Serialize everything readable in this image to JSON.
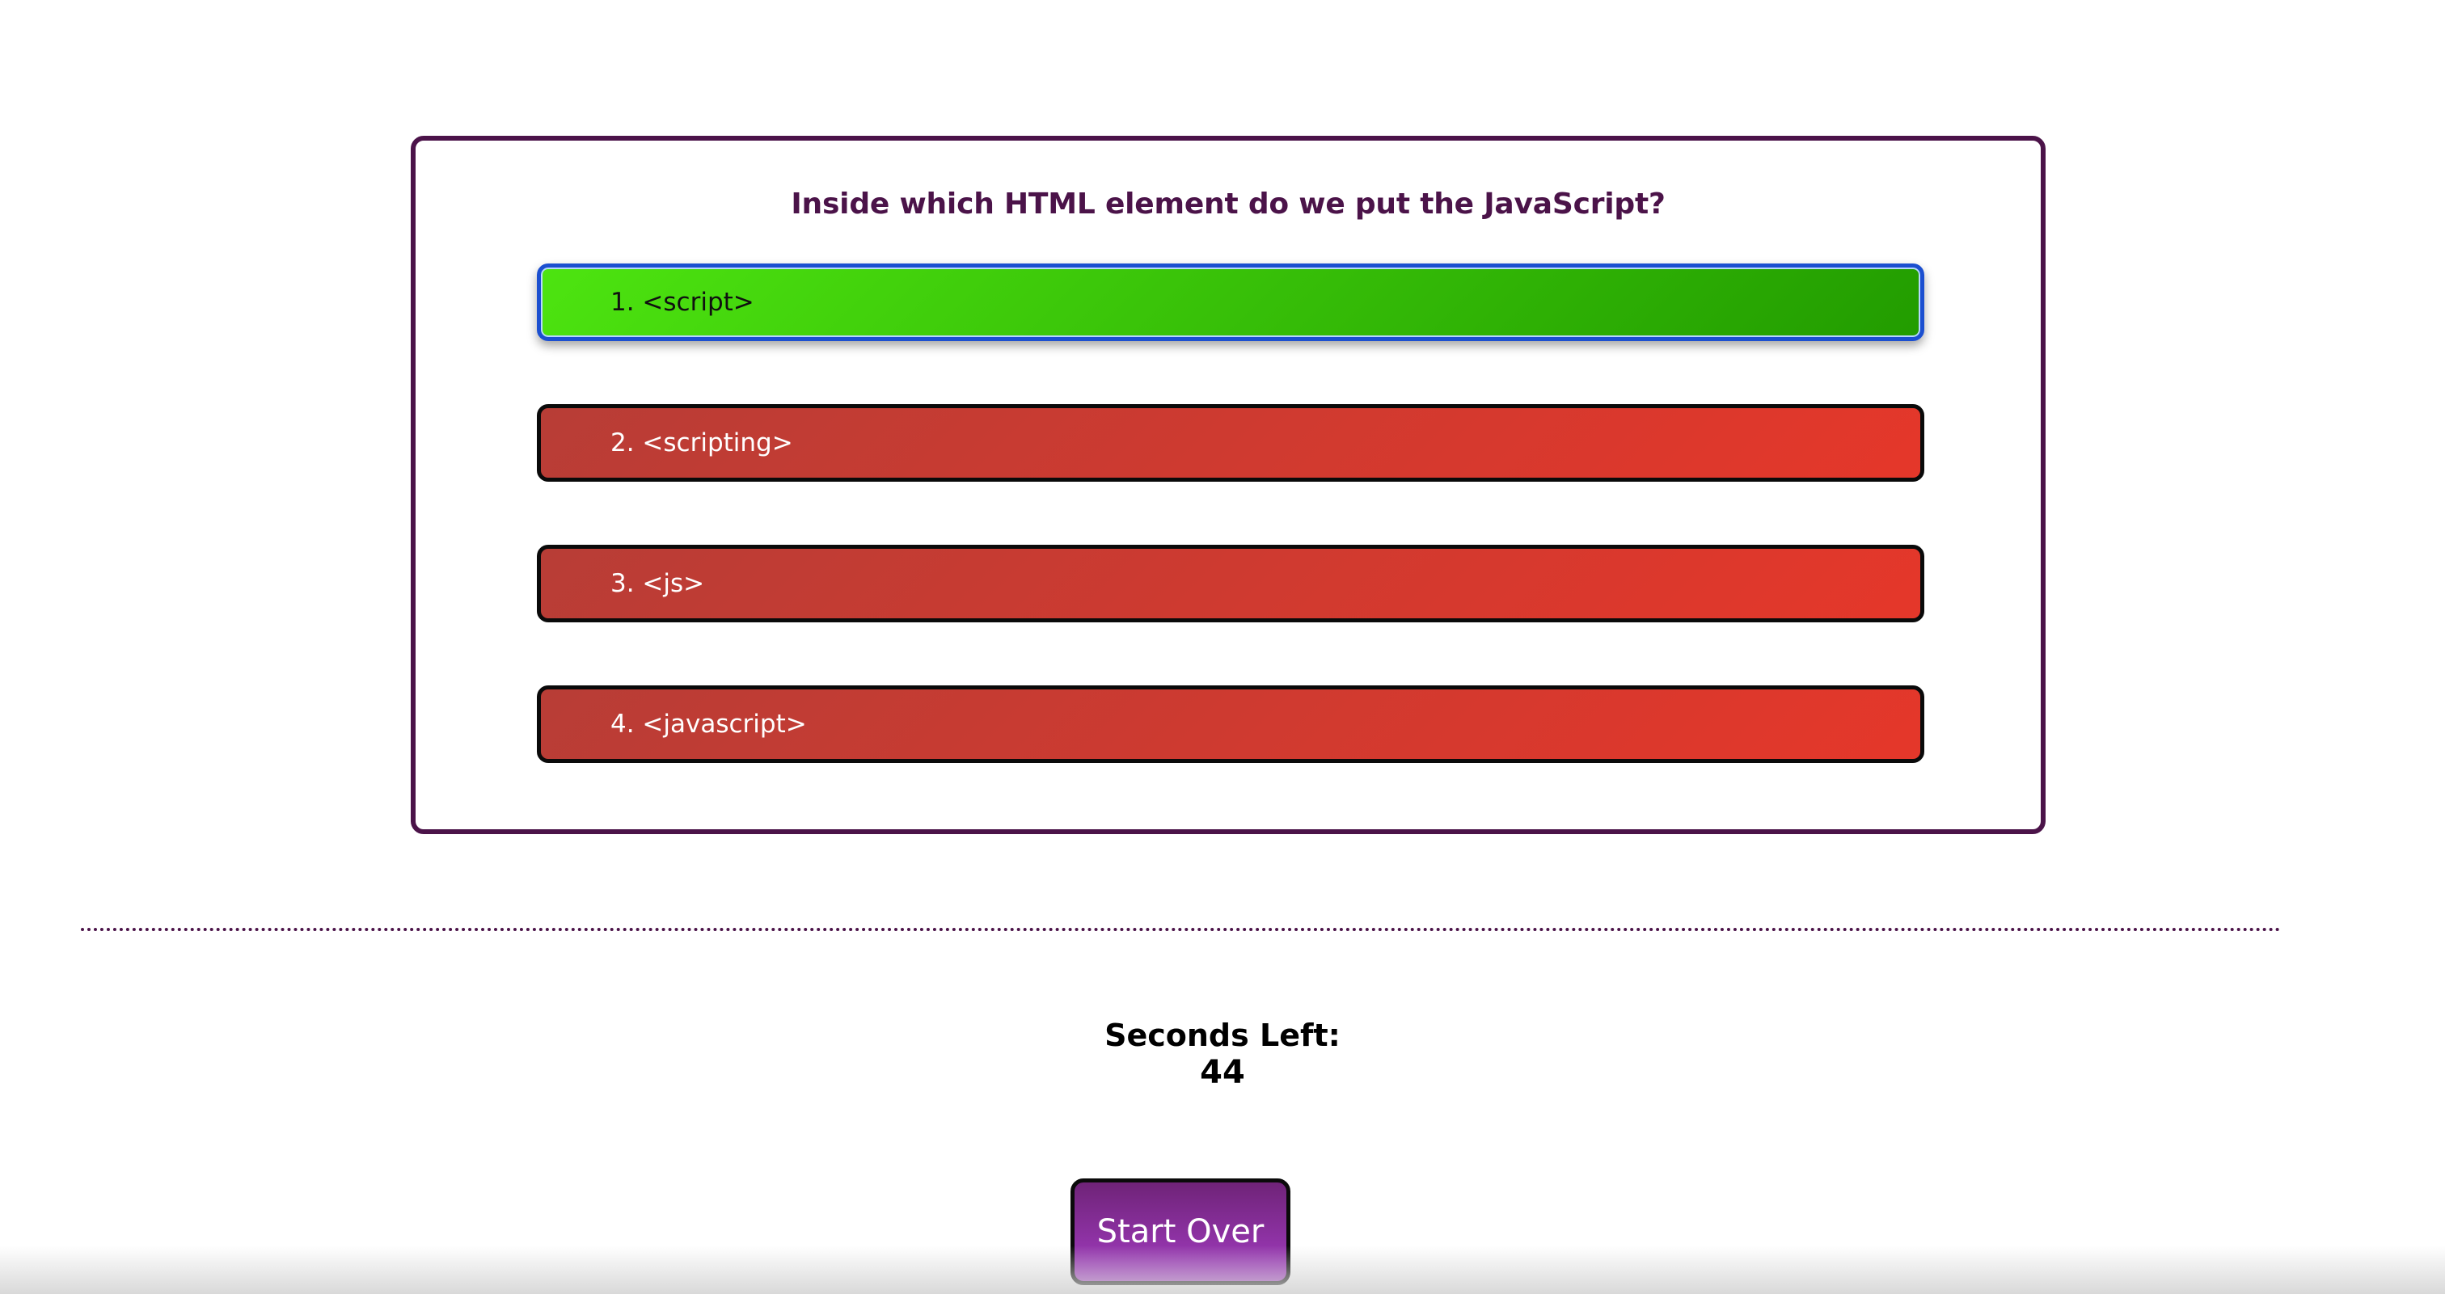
{
  "quiz": {
    "question": "Inside which HTML element do we put the JavaScript?",
    "choices": [
      {
        "label": "1. <script>",
        "state": "correct"
      },
      {
        "label": "2. <scripting>",
        "state": "wrong"
      },
      {
        "label": "3. <js>",
        "state": "wrong"
      },
      {
        "label": "4. <javascript>",
        "state": "wrong"
      }
    ]
  },
  "timer": {
    "label": "Seconds Left:",
    "value": "44"
  },
  "controls": {
    "start_over_label": "Start Over"
  },
  "colors": {
    "accent": "#4b1349",
    "correct": "#4de410",
    "wrong": "#e5372a",
    "button": "#a43dc4"
  }
}
